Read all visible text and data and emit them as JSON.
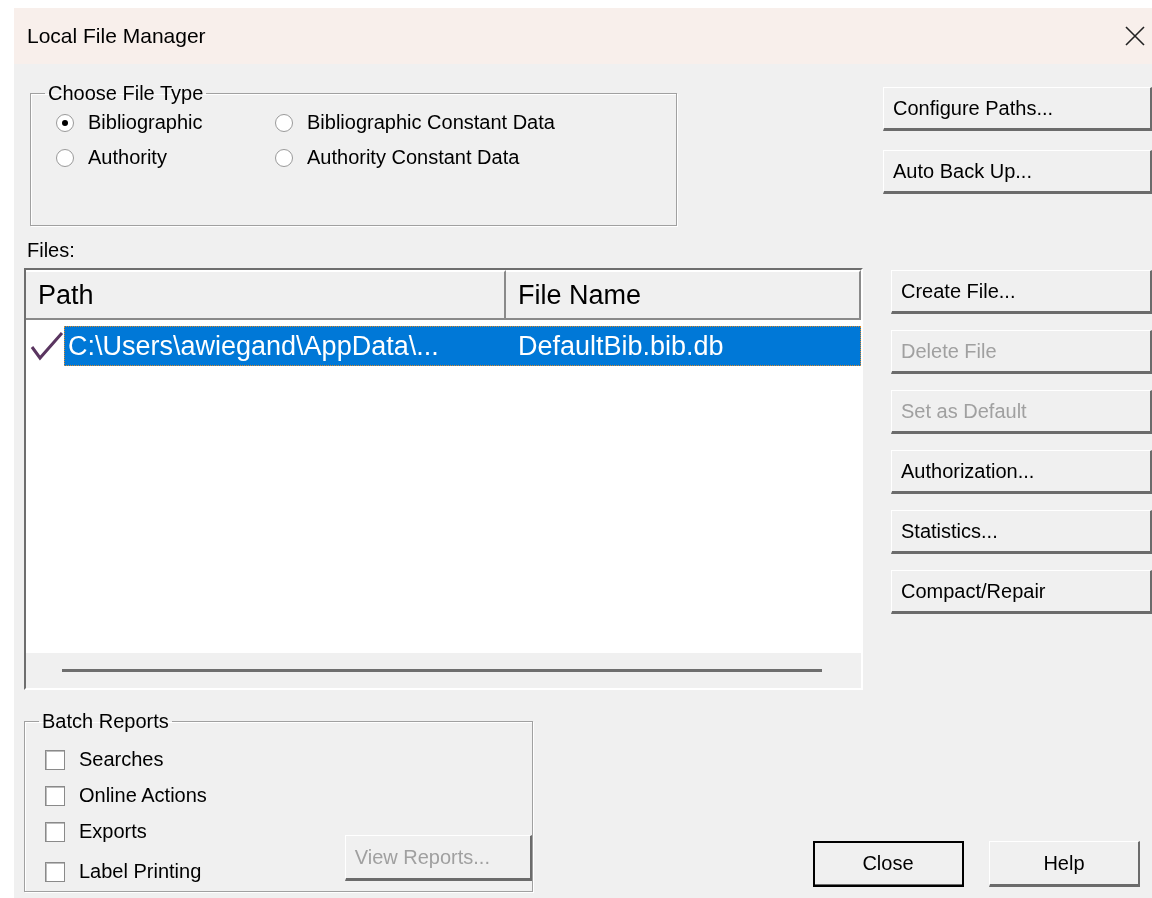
{
  "window": {
    "title": "Local File Manager"
  },
  "file_type": {
    "label": "Choose File Type",
    "options": [
      {
        "label": "Bibliographic",
        "selected": true
      },
      {
        "label": "Bibliographic Constant Data",
        "selected": false
      },
      {
        "label": "Authority",
        "selected": false
      },
      {
        "label": "Authority Constant Data",
        "selected": false
      }
    ]
  },
  "top_buttons": [
    {
      "label": "Configure Paths...",
      "disabled": false
    },
    {
      "label": "Auto Back Up...",
      "disabled": false
    }
  ],
  "files": {
    "label": "Files:",
    "columns": [
      "Path",
      "File Name"
    ],
    "rows": [
      {
        "checked": true,
        "selected": true,
        "path": "C:\\Users\\awiegand\\AppData\\...",
        "file_name": "DefaultBib.bib.db"
      }
    ]
  },
  "file_buttons": [
    {
      "label": "Create File...",
      "disabled": false
    },
    {
      "label": "Delete File",
      "disabled": true
    },
    {
      "label": "Set as Default",
      "disabled": true
    },
    {
      "label": "Authorization...",
      "disabled": false
    },
    {
      "label": "Statistics...",
      "disabled": false
    },
    {
      "label": "Compact/Repair",
      "disabled": false
    }
  ],
  "batch_reports": {
    "label": "Batch Reports",
    "options": [
      {
        "label": "Searches",
        "checked": false
      },
      {
        "label": "Online Actions",
        "checked": false
      },
      {
        "label": "Exports",
        "checked": false
      },
      {
        "label": "Label Printing",
        "checked": false
      }
    ],
    "view_button": {
      "label": "View Reports...",
      "disabled": true
    }
  },
  "dialog_buttons": [
    {
      "label": "Close",
      "default": true
    },
    {
      "label": "Help",
      "default": false
    }
  ]
}
